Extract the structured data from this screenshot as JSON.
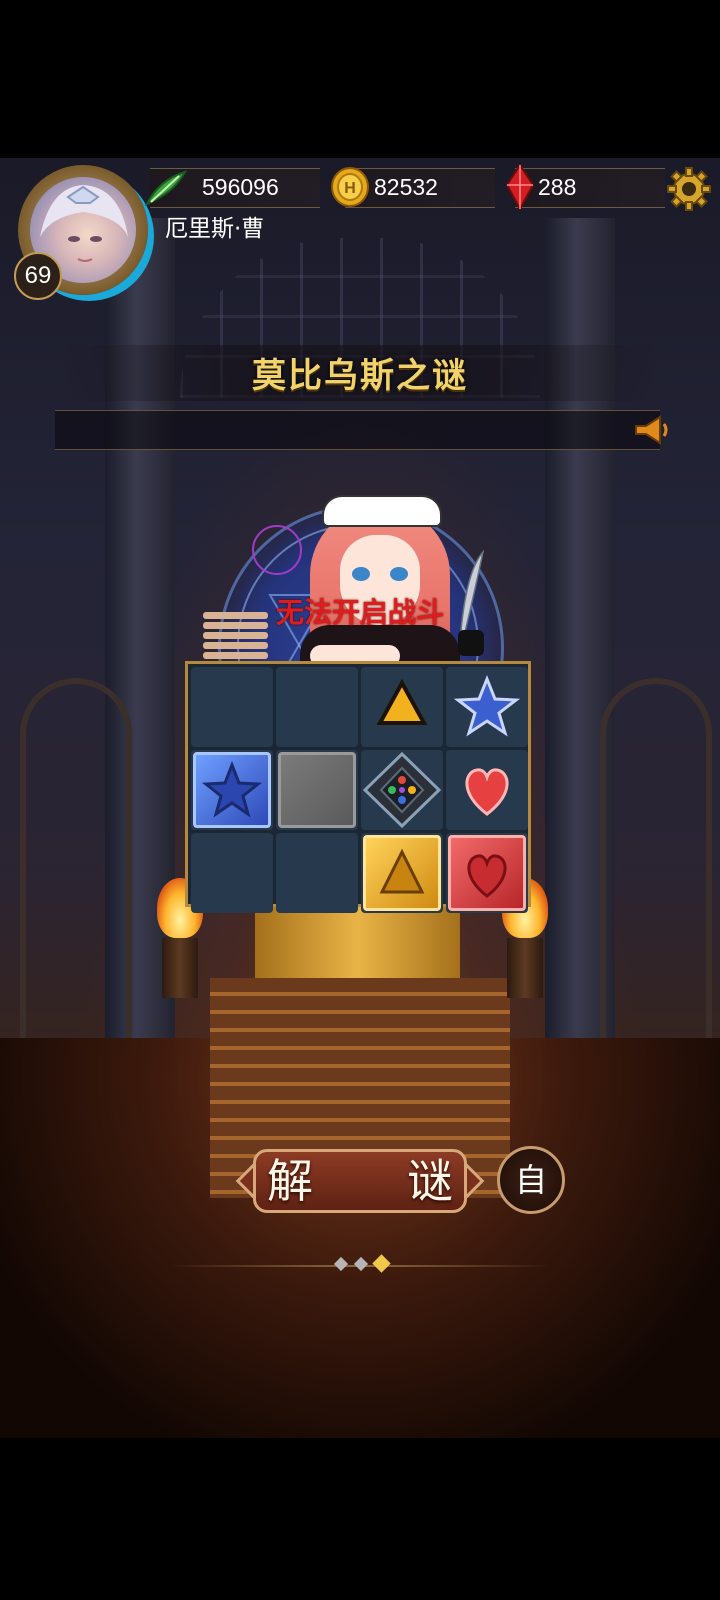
{
  "player": {
    "level": "69",
    "name": "厄里斯·曹"
  },
  "resources": {
    "stamina": "596096",
    "gold": "82532",
    "gems": "288"
  },
  "icons": {
    "stamina": "green-feather-icon",
    "gold": "gold-coin-icon",
    "gems": "red-crystal-icon",
    "settings": "gear-icon",
    "notice": "speaker-icon"
  },
  "puzzle": {
    "title": "莫比乌斯之谜",
    "warning": "无法开启战斗",
    "grid": [
      [
        "empty",
        "empty",
        "triangle-gold",
        "star-blue"
      ],
      [
        "star-block-blue",
        "stone-block-gray",
        "rune-tile",
        "heart-red"
      ],
      [
        "empty",
        "empty",
        "triangle-block-gold",
        "heart-block-red"
      ]
    ]
  },
  "actions": {
    "solve": "解　谜",
    "auto": "自"
  },
  "pager": {
    "count": 3,
    "active": 2
  },
  "colors": {
    "title": "#f2d36b",
    "warning": "#e11c1c",
    "board_border": "#b68a3c"
  }
}
